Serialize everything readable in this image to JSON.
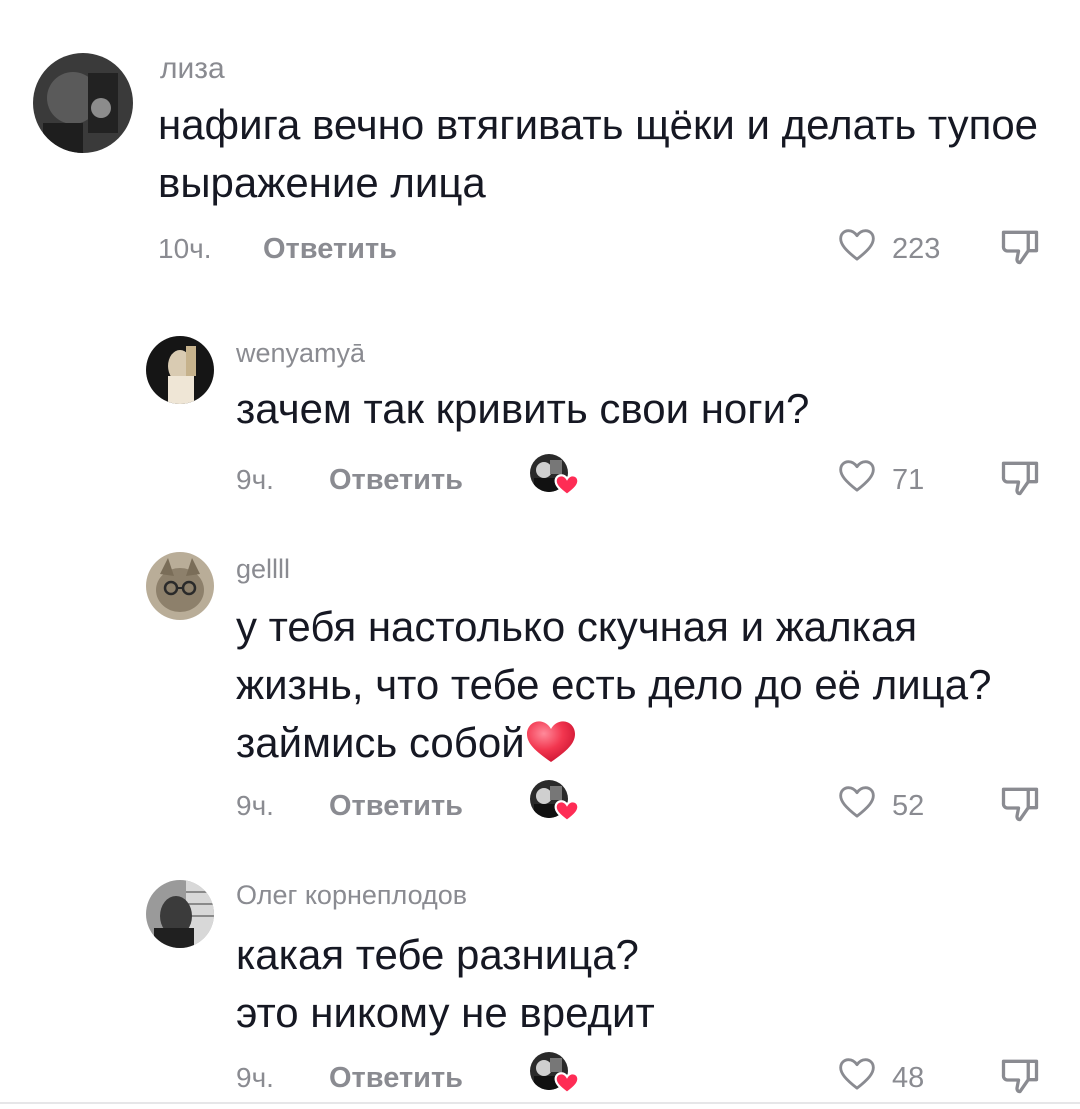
{
  "comments": [
    {
      "username": "лиза",
      "text": "нафига вечно втягивать щёки и делать тупое выражение лица",
      "time": "10ч.",
      "reply_label": "Ответить",
      "likes": "223",
      "creator_liked": false
    },
    {
      "username": "wenyamyā",
      "text": "зачем так кривить свои ноги?",
      "time": "9ч.",
      "reply_label": "Ответить",
      "likes": "71",
      "creator_liked": true
    },
    {
      "username": "gellll",
      "text": "у тебя настолько скучная и жалкая жизнь, что тебе есть дело до её лица? займись собой",
      "time": "9ч.",
      "reply_label": "Ответить",
      "likes": "52",
      "creator_liked": true,
      "trailing_emoji": "red-heart-emoji"
    },
    {
      "username": "Олег корнеплодов",
      "text_line1": "какая тебе разница?",
      "text_line2": "это никому не вредит",
      "time": "9ч.",
      "reply_label": "Ответить",
      "likes": "48",
      "creator_liked": true
    }
  ],
  "icons": {
    "like": "heart-outline-icon",
    "dislike": "thumbs-down-outline-icon",
    "creator_like": "creator-avatar-with-red-heart"
  },
  "colors": {
    "text": "#161823",
    "muted": "#8a8b91",
    "heart_red": "#fe2c55"
  }
}
